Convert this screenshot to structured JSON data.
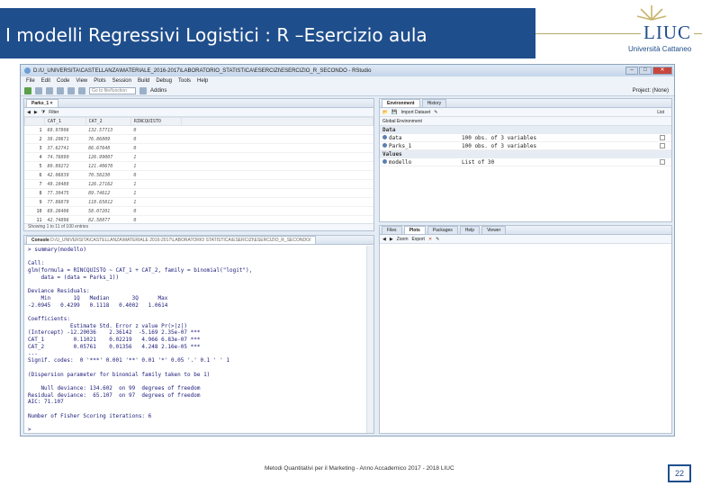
{
  "slide": {
    "title": "I modelli Regressivi Logistici : R –Esercizio aula",
    "logo_text": "LIUC",
    "logo_subtitle": "Università Cattaneo",
    "footer": "Metodi Quantitativi per il Marketing - Anno Accademico 2017 - 2018 LIUC",
    "page_number": "22",
    "accent_color": "#1f4e8c"
  },
  "rstudio": {
    "window_title": "D:/U_UNIVERSITA\\CASTELLANZA\\MATERIALE_2016-2017\\LABORATORIO_STATISTICA\\ESERCIZI\\ESERCIZIO_R_SECONDO - RStudio",
    "menu": [
      "File",
      "Edit",
      "Code",
      "View",
      "Plots",
      "Session",
      "Build",
      "Debug",
      "Tools",
      "Help"
    ],
    "goto_placeholder": "Go to file/function",
    "addins_label": "Addins",
    "project_label": "Project: (None)",
    "source": {
      "tab": "Parks_1",
      "filter_label": "Filter",
      "columns": [
        "",
        "CAT_1",
        "CAT_2",
        "RINCQUISTO"
      ],
      "rows": [
        [
          "1",
          "69.97806",
          "132.57713",
          "0"
        ],
        [
          "2",
          "38.20671",
          "76.86809",
          "0"
        ],
        [
          "3",
          "37.62741",
          "86.67648",
          "0"
        ],
        [
          "4",
          "74.76890",
          "126.99007",
          "1"
        ],
        [
          "5",
          "80.80272",
          "121.40670",
          "1"
        ],
        [
          "6",
          "42.06839",
          "70.58230",
          "0"
        ],
        [
          "7",
          "49.10488",
          "126.27162",
          "1"
        ],
        [
          "8",
          "77.30475",
          "89.74612",
          "1"
        ],
        [
          "9",
          "77.86879",
          "118.65812",
          "1"
        ],
        [
          "10",
          "69.26406",
          "58.07201",
          "0"
        ],
        [
          "11",
          "42.74896",
          "82.58877",
          "0"
        ]
      ],
      "footer": "Showing 1 to 11 of 100 entries"
    },
    "console": {
      "tab": "Console",
      "path": "D:/U_UNIVERSITA\\CASTELLANZA\\MATERIALE 2016-2017\\LABORATORIO STATISTICA\\ESERCIZI\\ESERCIZIO_R_SECONDO/",
      "output": "> summary(modello)\n\nCall:\nglm(formula = RINCQUISTO ~ CAT_1 + CAT_2, family = binomial(\"logit\"),\n    data = (data = Parks_1))\n\nDeviance Residuals:\n    Min       1Q   Median       3Q      Max\n-2.0945   0.4299   0.1118   0.4002   1.0614\n\nCoefficients:\n             Estimate Std. Error z value Pr(>|z|)\n(Intercept) -12.20036    2.36142  -5.169 2.35e-07 ***\nCAT_1         0.11021    0.02219   4.966 6.83e-07 ***\nCAT_2         0.05761    0.01356   4.248 2.16e-05 ***\n---\nSignif. codes:  0 '***' 0.001 '**' 0.01 '*' 0.05 '.' 0.1 ' ' 1\n\n(Dispersion parameter for binomial family taken to be 1)\n\n    Null deviance: 134.602  on 99  degrees of freedom\nResidual deviance:  65.107  on 97  degrees of freedom\nAIC: 71.107\n\nNumber of Fisher Scoring iterations: 6\n\n>"
    },
    "environment": {
      "tabs": [
        "Environment",
        "History"
      ],
      "import_label": "Import Dataset",
      "scope_label": "Global Environment",
      "list_label": "List",
      "data_header": "Data",
      "values_header": "Values",
      "data": [
        {
          "name": "data",
          "value": "100 obs. of 3 variables"
        },
        {
          "name": "Parks_1",
          "value": "100 obs. of 3 variables"
        }
      ],
      "values": [
        {
          "name": "modello",
          "value": "List of 30"
        }
      ]
    },
    "files": {
      "tabs": [
        "Files",
        "Plots",
        "Packages",
        "Help",
        "Viewer"
      ],
      "zoom_label": "Zoom",
      "export_label": "Export"
    }
  }
}
